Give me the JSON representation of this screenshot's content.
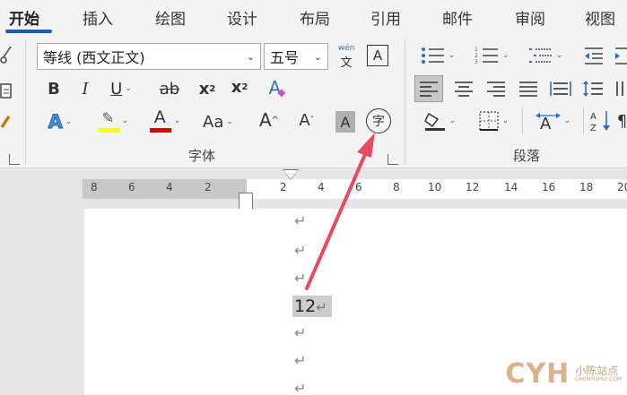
{
  "tabs": [
    {
      "label": "开始",
      "active": true
    },
    {
      "label": "插入"
    },
    {
      "label": "绘图"
    },
    {
      "label": "设计"
    },
    {
      "label": "布局"
    },
    {
      "label": "引用"
    },
    {
      "label": "邮件"
    },
    {
      "label": "审阅"
    },
    {
      "label": "视图"
    }
  ],
  "font_group": {
    "font_name": "等线 (西文正文)",
    "font_size": "五号",
    "phonetic_top": "wén",
    "phonetic_bottom": "文",
    "char_border": "A",
    "bold": "B",
    "italic": "I",
    "underline": "U",
    "strike": "ab",
    "subscript": "x",
    "subscript_mark": "2",
    "superscript": "x",
    "superscript_mark": "2",
    "clear_format": "A",
    "text_effect": "A",
    "font_color": "A",
    "change_case": "Aa",
    "grow": "A",
    "shrink": "A",
    "char_shading": "A",
    "enclose_char": "字",
    "label": "字体"
  },
  "paragraph_group": {
    "label": "段落"
  },
  "ruler_ticks": [
    "8",
    "6",
    "4",
    "2",
    "2",
    "4",
    "6",
    "8",
    "10",
    "12",
    "14",
    "16",
    "18",
    "20"
  ],
  "document": {
    "para_mark": "↵",
    "selected_text": "12",
    "selected_mark": "↵"
  },
  "watermark": {
    "logo": "CYH",
    "cn": "小陈站点",
    "en": "CHENYUHUI.COM"
  },
  "colors": {
    "accent_tab": "#185abd",
    "highlight_yellow": "#ffff00",
    "font_red": "#e00000",
    "annotation_arrow": "#e84a5f"
  }
}
